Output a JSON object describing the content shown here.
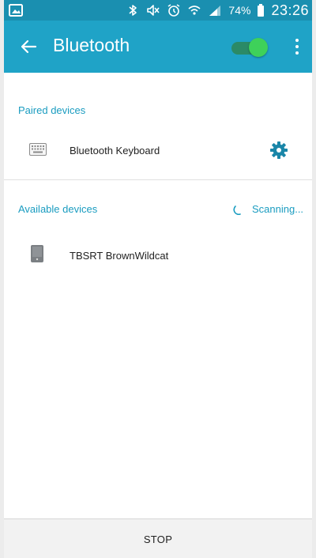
{
  "status_bar": {
    "battery_percent": "74%",
    "time": "23:26",
    "icons": [
      "image-icon",
      "bluetooth-icon",
      "mute-icon",
      "alarm-icon",
      "wifi-icon",
      "signal-icon",
      "battery-icon"
    ]
  },
  "app_bar": {
    "title": "Bluetooth",
    "toggle_state": "on",
    "colors": {
      "bar": "#1fa3c7",
      "toggle_track": "#2b8a67",
      "toggle_knob": "#3ed15a"
    }
  },
  "paired": {
    "label": "Paired devices",
    "devices": [
      {
        "name": "Bluetooth Keyboard",
        "icon": "keyboard-icon",
        "action_icon": "settings-gear-icon"
      }
    ]
  },
  "available": {
    "label": "Available devices",
    "scan_status": "Scanning...",
    "devices": [
      {
        "name": "TBSRT BrownWildcat",
        "icon": "phone-icon"
      }
    ]
  },
  "footer": {
    "stop_label": "STOP"
  }
}
